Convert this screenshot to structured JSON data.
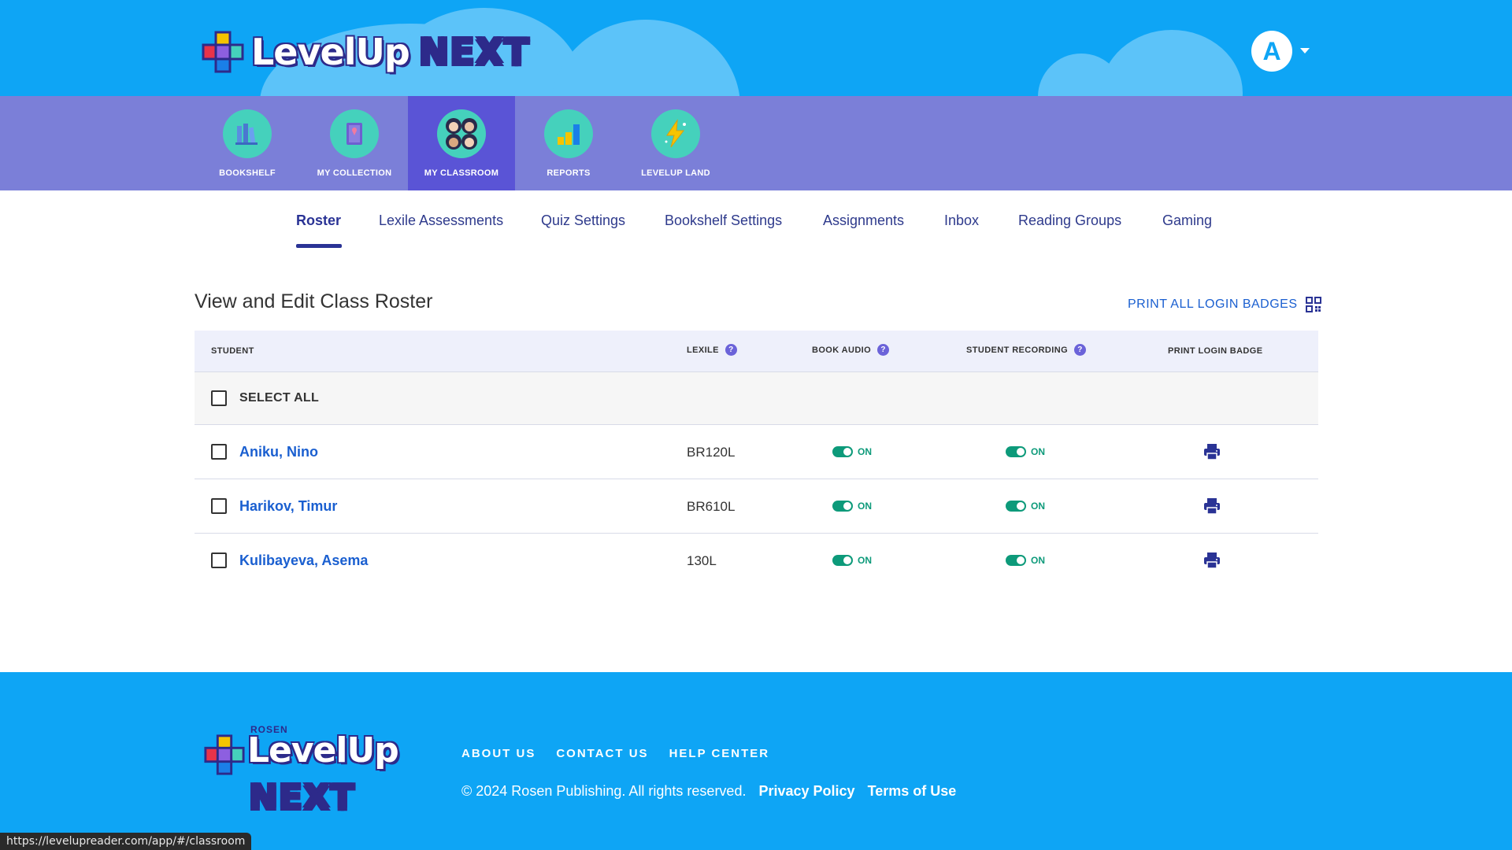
{
  "brand": {
    "name": "LevelUp",
    "suffix": "NEXT",
    "next_colors": [
      "#e8334a",
      "#f5c400",
      "#45d1bc",
      "#8d5fe0"
    ]
  },
  "user": {
    "initial": "A"
  },
  "nav": [
    {
      "label": "BOOKSHELF",
      "icon": "books-icon",
      "active": false
    },
    {
      "label": "MY COLLECTION",
      "icon": "collection-book-icon",
      "active": false
    },
    {
      "label": "MY CLASSROOM",
      "icon": "students-icon",
      "active": true
    },
    {
      "label": "REPORTS",
      "icon": "bar-chart-icon",
      "active": false
    },
    {
      "label": "LEVELUP LAND",
      "icon": "lightning-icon",
      "active": false
    }
  ],
  "tabs": [
    {
      "label": "Roster",
      "active": true
    },
    {
      "label": "Lexile Assessments"
    },
    {
      "label": "Quiz Settings"
    },
    {
      "label": "Bookshelf Settings"
    },
    {
      "label": "Assignments"
    },
    {
      "label": "Inbox"
    },
    {
      "label": "Reading Groups"
    },
    {
      "label": "Gaming"
    }
  ],
  "page": {
    "title": "View and Edit Class Roster",
    "print_all_label": "PRINT ALL LOGIN BADGES"
  },
  "table": {
    "headers": {
      "student": "STUDENT",
      "lexile": "LEXILE",
      "book_audio": "BOOK AUDIO",
      "student_recording": "STUDENT RECORDING",
      "print_badge": "PRINT LOGIN BADGE"
    },
    "help_glyph": "?",
    "select_all": "SELECT ALL",
    "on_label": "ON",
    "rows": [
      {
        "name": "Aniku, Nino",
        "lexile": "BR120L",
        "book_audio": "ON",
        "student_recording": "ON"
      },
      {
        "name": "Harikov, Timur",
        "lexile": "BR610L",
        "book_audio": "ON",
        "student_recording": "ON"
      },
      {
        "name": "Kulibayeva, Asema",
        "lexile": "130L",
        "book_audio": "ON",
        "student_recording": "ON"
      }
    ]
  },
  "footer": {
    "rosen": "ROSEN",
    "links": [
      "ABOUT US",
      "CONTACT US",
      "HELP CENTER"
    ],
    "copyright": "© 2024 Rosen Publishing. All rights reserved.",
    "privacy": "Privacy Policy",
    "terms": "Terms of Use"
  },
  "status_url": "https://levelupreader.com/app/#/classroom",
  "colors": {
    "header_bg": "#0ea5f5",
    "nav_bg": "#7b7fd8",
    "nav_active": "#5a54d6",
    "accent": "#2a3395",
    "toggle_on": "#0d9a7a"
  }
}
